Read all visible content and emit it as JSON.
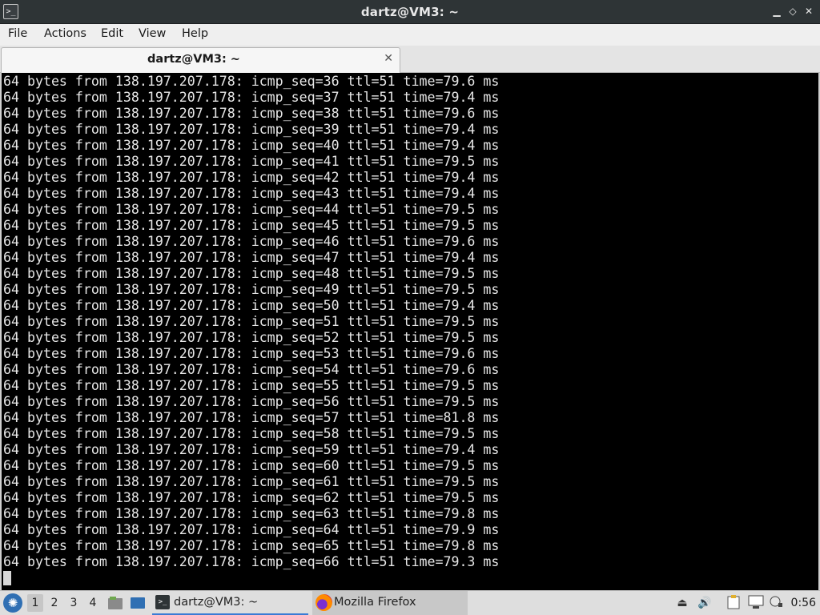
{
  "window": {
    "title": "dartz@VM3: ~",
    "icon": "terminal-icon",
    "controls": {
      "minimize": "▁",
      "restore": "◇",
      "close": "✕"
    }
  },
  "menubar": {
    "items": [
      "File",
      "Actions",
      "Edit",
      "View",
      "Help"
    ]
  },
  "tabs": [
    {
      "label": "dartz@VM3: ~",
      "close": "✕"
    }
  ],
  "terminal": {
    "lines": [
      "64 bytes from 138.197.207.178: icmp_seq=36 ttl=51 time=79.6 ms",
      "64 bytes from 138.197.207.178: icmp_seq=37 ttl=51 time=79.4 ms",
      "64 bytes from 138.197.207.178: icmp_seq=38 ttl=51 time=79.6 ms",
      "64 bytes from 138.197.207.178: icmp_seq=39 ttl=51 time=79.4 ms",
      "64 bytes from 138.197.207.178: icmp_seq=40 ttl=51 time=79.4 ms",
      "64 bytes from 138.197.207.178: icmp_seq=41 ttl=51 time=79.5 ms",
      "64 bytes from 138.197.207.178: icmp_seq=42 ttl=51 time=79.4 ms",
      "64 bytes from 138.197.207.178: icmp_seq=43 ttl=51 time=79.4 ms",
      "64 bytes from 138.197.207.178: icmp_seq=44 ttl=51 time=79.5 ms",
      "64 bytes from 138.197.207.178: icmp_seq=45 ttl=51 time=79.5 ms",
      "64 bytes from 138.197.207.178: icmp_seq=46 ttl=51 time=79.6 ms",
      "64 bytes from 138.197.207.178: icmp_seq=47 ttl=51 time=79.4 ms",
      "64 bytes from 138.197.207.178: icmp_seq=48 ttl=51 time=79.5 ms",
      "64 bytes from 138.197.207.178: icmp_seq=49 ttl=51 time=79.5 ms",
      "64 bytes from 138.197.207.178: icmp_seq=50 ttl=51 time=79.4 ms",
      "64 bytes from 138.197.207.178: icmp_seq=51 ttl=51 time=79.5 ms",
      "64 bytes from 138.197.207.178: icmp_seq=52 ttl=51 time=79.5 ms",
      "64 bytes from 138.197.207.178: icmp_seq=53 ttl=51 time=79.6 ms",
      "64 bytes from 138.197.207.178: icmp_seq=54 ttl=51 time=79.6 ms",
      "64 bytes from 138.197.207.178: icmp_seq=55 ttl=51 time=79.5 ms",
      "64 bytes from 138.197.207.178: icmp_seq=56 ttl=51 time=79.5 ms",
      "64 bytes from 138.197.207.178: icmp_seq=57 ttl=51 time=81.8 ms",
      "64 bytes from 138.197.207.178: icmp_seq=58 ttl=51 time=79.5 ms",
      "64 bytes from 138.197.207.178: icmp_seq=59 ttl=51 time=79.4 ms",
      "64 bytes from 138.197.207.178: icmp_seq=60 ttl=51 time=79.5 ms",
      "64 bytes from 138.197.207.178: icmp_seq=61 ttl=51 time=79.5 ms",
      "64 bytes from 138.197.207.178: icmp_seq=62 ttl=51 time=79.5 ms",
      "64 bytes from 138.197.207.178: icmp_seq=63 ttl=51 time=79.8 ms",
      "64 bytes from 138.197.207.178: icmp_seq=64 ttl=51 time=79.9 ms",
      "64 bytes from 138.197.207.178: icmp_seq=65 ttl=51 time=79.8 ms",
      "64 bytes from 138.197.207.178: icmp_seq=66 ttl=51 time=79.3 ms"
    ]
  },
  "taskbar": {
    "workspaces": [
      "1",
      "2",
      "3",
      "4"
    ],
    "active_workspace": "1",
    "launchers": [
      "files-icon",
      "desktop-icon"
    ],
    "tasks": [
      {
        "label": "dartz@VM3: ~",
        "icon": "terminal-icon",
        "active": true
      },
      {
        "label": "Mozilla Firefox",
        "icon": "firefox-icon",
        "active": false
      }
    ],
    "tray": [
      "eject-icon",
      "volume-icon",
      "clipboard-icon",
      "network-icon",
      "notification-icon"
    ],
    "clock": "0:56"
  }
}
